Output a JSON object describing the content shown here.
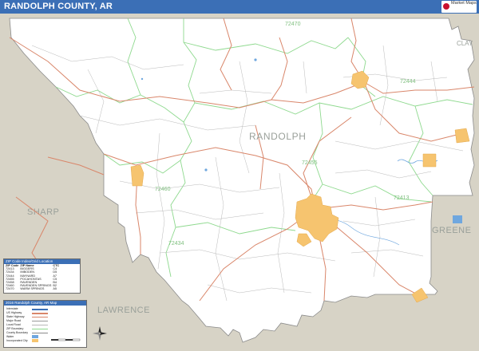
{
  "header": {
    "title": "RANDOLPH COUNTY, AR",
    "logo_text": "Market Maps"
  },
  "colors": {
    "title_bar": "#3b6fb6",
    "county_fill": "#ffffff",
    "outside_fill": "#d7d3c6",
    "zip_boundary": "#8ed98e",
    "highway": "#d9866a",
    "local_road": "#b9b9b9",
    "city_fill": "#f6c46f",
    "water": "#6fa7df",
    "county_label": "#9aa09a",
    "zip_label": "#7fbf7f"
  },
  "labels": {
    "county": "RANDOLPH",
    "neighbors": [
      {
        "name": "SHARP"
      },
      {
        "name": "LAWRENCE"
      },
      {
        "name": "GREENE"
      },
      {
        "name": "CLAY"
      }
    ],
    "zip_codes": [
      "72470",
      "72444",
      "72455",
      "72460",
      "72413",
      "72434"
    ]
  },
  "zip_index": {
    "title": "ZIP Code Index/Grid Location",
    "columns": [
      "ZIP Code",
      "ZIP Name",
      "CTC"
    ],
    "rows": [
      [
        "72413",
        "BIGGERS",
        "C4"
      ],
      [
        "72434",
        "IMBODEN",
        "D5"
      ],
      [
        "72444",
        "MAYNARD",
        "A7"
      ],
      [
        "72455",
        "POCAHONTAS",
        "C5"
      ],
      [
        "72458",
        "RAVENDEN",
        "B4"
      ],
      [
        "72460",
        "RAVENDEN SPRINGS",
        "B2"
      ],
      [
        "72470",
        "WARM SPRINGS",
        "A5"
      ]
    ]
  },
  "map_legend": {
    "title": "2016 Randolph County, AR Map",
    "items": [
      {
        "label": "Interstate"
      },
      {
        "label": "US Highway"
      },
      {
        "label": "State Highway"
      },
      {
        "label": "Major Road"
      },
      {
        "label": "Local Road"
      },
      {
        "label": "ZIP Boundary"
      },
      {
        "label": "County Boundary"
      },
      {
        "label": "Water"
      },
      {
        "label": "Incorporated City"
      }
    ]
  }
}
